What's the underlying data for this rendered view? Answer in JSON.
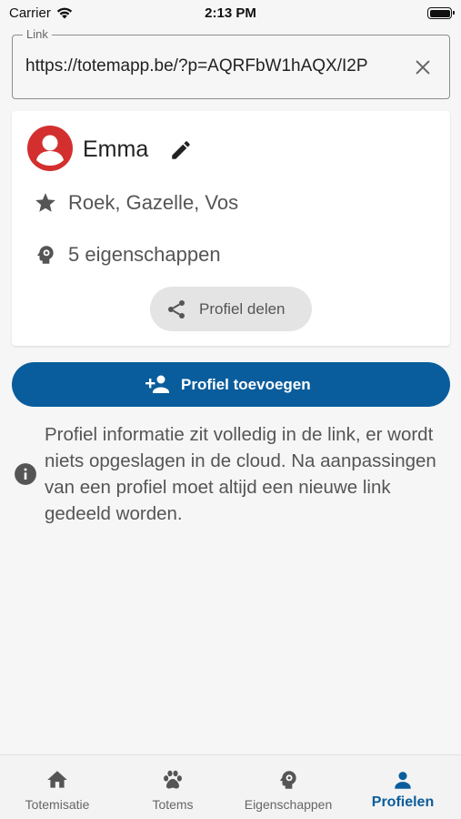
{
  "status_bar": {
    "carrier": "Carrier",
    "time": "2:13 PM"
  },
  "link_field": {
    "label": "Link",
    "value": "https://totemapp.be/?p=AQRFbW1hAQX/I2P"
  },
  "profile": {
    "name": "Emma",
    "avatar_color": "#d32f2f",
    "totems": "Roek, Gazelle, Vos",
    "traits_count": "5 eigenschappen",
    "share_label": "Profiel delen"
  },
  "add_profile_label": "Profiel toevoegen",
  "info": {
    "text": "Profiel informatie zit volledig in de link, er wordt niets opgeslagen in de cloud. Na aanpassingen van een profiel moet altijd een nieuwe link gedeeld worden."
  },
  "bottom_nav": {
    "active_color": "#0a5d9c",
    "items": [
      {
        "label": "Totemisatie",
        "icon": "home-icon"
      },
      {
        "label": "Totems",
        "icon": "paw-icon"
      },
      {
        "label": "Eigenschappen",
        "icon": "head-gear-icon"
      },
      {
        "label": "Profielen",
        "icon": "person-icon"
      }
    ]
  }
}
